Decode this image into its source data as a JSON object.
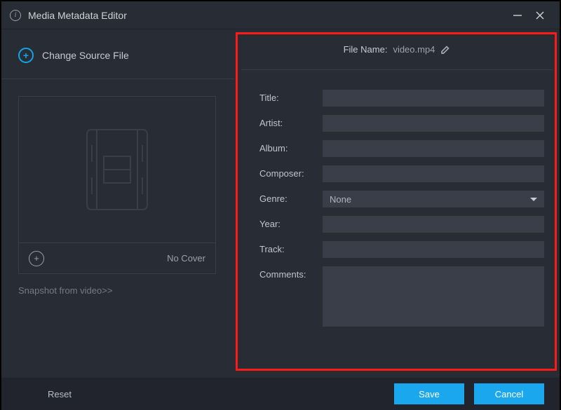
{
  "window": {
    "title": "Media Metadata Editor"
  },
  "left": {
    "change_source": "Change Source File",
    "no_cover": "No Cover",
    "snapshot_link": "Snapshot from video>>"
  },
  "file": {
    "name_label": "File Name:",
    "name_value": "video.mp4"
  },
  "form": {
    "title_label": "Title:",
    "title_value": "",
    "artist_label": "Artist:",
    "artist_value": "",
    "album_label": "Album:",
    "album_value": "",
    "composer_label": "Composer:",
    "composer_value": "",
    "genre_label": "Genre:",
    "genre_value": "None",
    "year_label": "Year:",
    "year_value": "",
    "track_label": "Track:",
    "track_value": "",
    "comments_label": "Comments:",
    "comments_value": ""
  },
  "footer": {
    "reset": "Reset",
    "save": "Save",
    "cancel": "Cancel"
  },
  "colors": {
    "bg": "#282c35",
    "panel": "#21242c",
    "input": "#3a3e48",
    "accent": "#1aa7ee",
    "highlight": "#ff1a1a"
  }
}
